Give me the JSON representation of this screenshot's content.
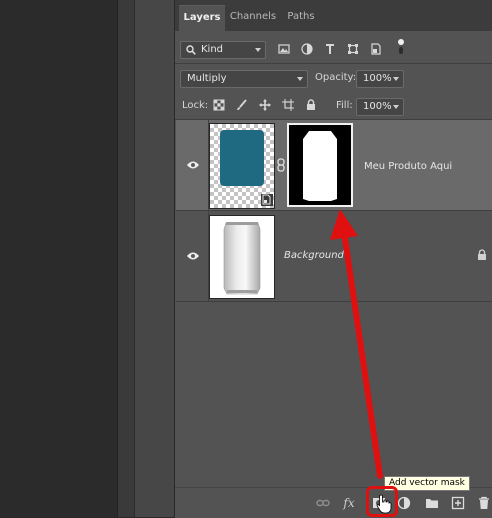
{
  "tabs": [
    {
      "label": "Layers",
      "active": true
    },
    {
      "label": "Channels",
      "active": false
    },
    {
      "label": "Paths",
      "active": false
    }
  ],
  "filter": {
    "kind_label": "Kind"
  },
  "blend": {
    "mode": "Multiply",
    "opacity_label": "Opacity:",
    "opacity_value": "100%"
  },
  "lock": {
    "label": "Lock:",
    "fill_label": "Fill:",
    "fill_value": "100%"
  },
  "layers": [
    {
      "name": "Meu Produto Aqui",
      "selected": true,
      "visible": true,
      "thumb_color": "#1f6a80"
    },
    {
      "name": "Background",
      "selected": false,
      "visible": true,
      "locked": true
    }
  ],
  "tooltip": "Add vector mask",
  "colors": {
    "highlight": "#e01010",
    "layer_fill": "#1f6a80",
    "panel_bg": "#535353"
  },
  "bottom_icons": [
    "link-icon",
    "fx-icon",
    "add-mask-icon",
    "adjustment-icon",
    "group-folder-icon",
    "new-layer-icon",
    "trash-icon"
  ]
}
